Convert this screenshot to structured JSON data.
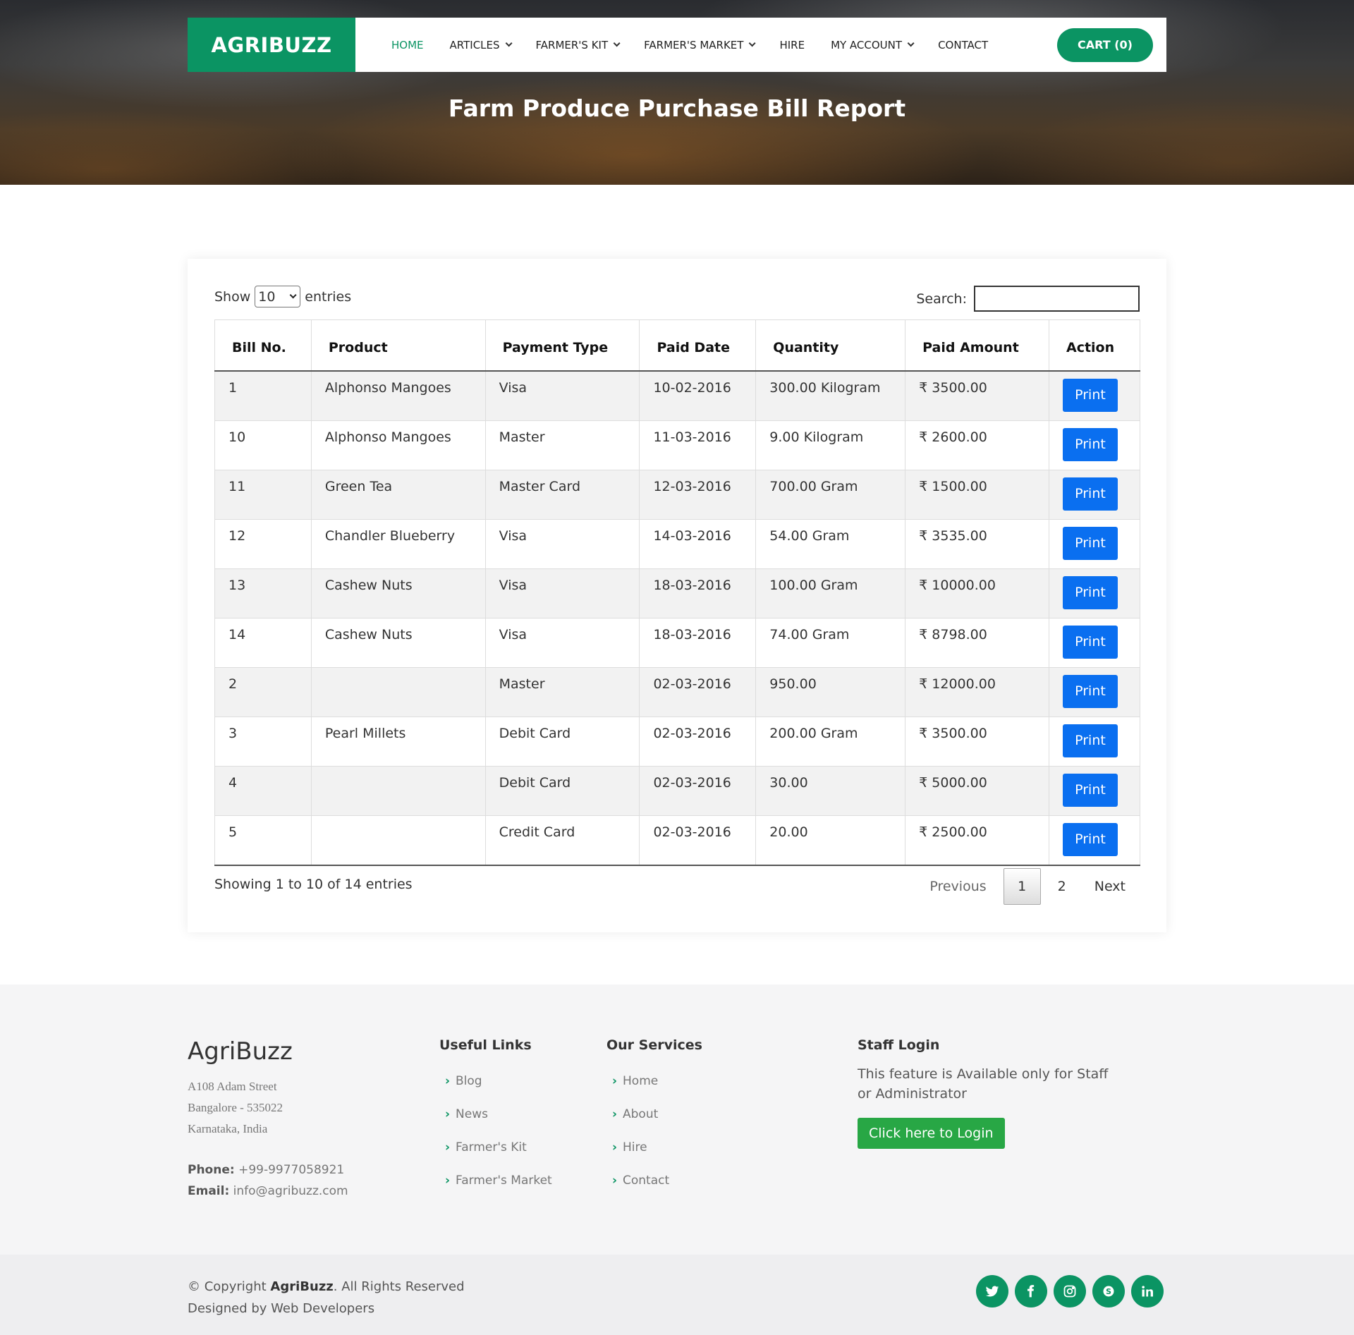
{
  "brand": "AGRIBUZZ",
  "nav": {
    "items": [
      {
        "label": "HOME",
        "dropdown": false,
        "active": true
      },
      {
        "label": "ARTICLES",
        "dropdown": true
      },
      {
        "label": "FARMER'S KIT",
        "dropdown": true
      },
      {
        "label": "FARMER'S MARKET",
        "dropdown": true
      },
      {
        "label": "HIRE",
        "dropdown": false
      },
      {
        "label": "MY ACCOUNT",
        "dropdown": true
      },
      {
        "label": "CONTACT",
        "dropdown": false
      }
    ],
    "cart_label": "CART (0)"
  },
  "page_title": "Farm Produce Purchase Bill Report",
  "table_controls": {
    "show_label": "Show",
    "entries_value": "10",
    "entries_label": "entries",
    "search_label": "Search:",
    "search_value": ""
  },
  "table": {
    "headers": [
      "Bill No.",
      "Product",
      "Payment Type",
      "Paid Date",
      "Quantity",
      "Paid Amount",
      "Action"
    ],
    "rows": [
      {
        "bill": "1",
        "product": "Alphonso Mangoes",
        "payment": "Visa",
        "date": "10-02-2016",
        "qty": "300.00 Kilogram",
        "amount": "₹ 3500.00",
        "action": "Print"
      },
      {
        "bill": "10",
        "product": "Alphonso Mangoes",
        "payment": "Master",
        "date": "11-03-2016",
        "qty": "9.00 Kilogram",
        "amount": "₹ 2600.00",
        "action": "Print"
      },
      {
        "bill": "11",
        "product": "Green Tea",
        "payment": "Master Card",
        "date": "12-03-2016",
        "qty": "700.00 Gram",
        "amount": "₹ 1500.00",
        "action": "Print"
      },
      {
        "bill": "12",
        "product": "Chandler Blueberry",
        "payment": "Visa",
        "date": "14-03-2016",
        "qty": "54.00 Gram",
        "amount": "₹ 3535.00",
        "action": "Print"
      },
      {
        "bill": "13",
        "product": "Cashew Nuts",
        "payment": "Visa",
        "date": "18-03-2016",
        "qty": "100.00 Gram",
        "amount": "₹ 10000.00",
        "action": "Print"
      },
      {
        "bill": "14",
        "product": "Cashew Nuts",
        "payment": "Visa",
        "date": "18-03-2016",
        "qty": "74.00 Gram",
        "amount": "₹ 8798.00",
        "action": "Print"
      },
      {
        "bill": "2",
        "product": "",
        "payment": "Master",
        "date": "02-03-2016",
        "qty": "950.00",
        "amount": "₹ 12000.00",
        "action": "Print"
      },
      {
        "bill": "3",
        "product": "Pearl Millets",
        "payment": "Debit Card",
        "date": "02-03-2016",
        "qty": "200.00 Gram",
        "amount": "₹ 3500.00",
        "action": "Print"
      },
      {
        "bill": "4",
        "product": "",
        "payment": "Debit Card",
        "date": "02-03-2016",
        "qty": "30.00",
        "amount": "₹ 5000.00",
        "action": "Print"
      },
      {
        "bill": "5",
        "product": "",
        "payment": "Credit Card",
        "date": "02-03-2016",
        "qty": "20.00",
        "amount": "₹ 2500.00",
        "action": "Print"
      }
    ]
  },
  "pagination": {
    "info": "Showing 1 to 10 of 14 entries",
    "previous": "Previous",
    "pages": [
      "1",
      "2"
    ],
    "current": "1",
    "next": "Next"
  },
  "footer": {
    "brand": "AgriBuzz",
    "address": [
      "A108 Adam Street",
      "Bangalore - 535022",
      "Karnataka, India"
    ],
    "phone_label": "Phone:",
    "phone": "+99-9977058921",
    "email_label": "Email:",
    "email": "info@agribuzz.com",
    "useful_links_title": "Useful Links",
    "useful_links": [
      "Blog",
      "News",
      "Farmer's Kit",
      "Farmer's Market"
    ],
    "services_title": "Our Services",
    "services": [
      "Home",
      "About",
      "Hire",
      "Contact"
    ],
    "staff_title": "Staff Login",
    "staff_text": "This feature is Available only for Staff or Administrator",
    "login_button": "Click here to Login"
  },
  "bottom_bar": {
    "copyright_prefix": "© Copyright",
    "copyright_brand": "AgriBuzz",
    "copyright_suffix": ". All Rights Reserved",
    "designed_by": "Designed by Web Developers",
    "socials": [
      "twitter-icon",
      "facebook-icon",
      "instagram-icon",
      "skype-icon",
      "linkedin-icon"
    ]
  },
  "colors": {
    "brand_green": "#0b9463",
    "print_blue": "#0a6ff0",
    "login_green": "#28a745"
  }
}
